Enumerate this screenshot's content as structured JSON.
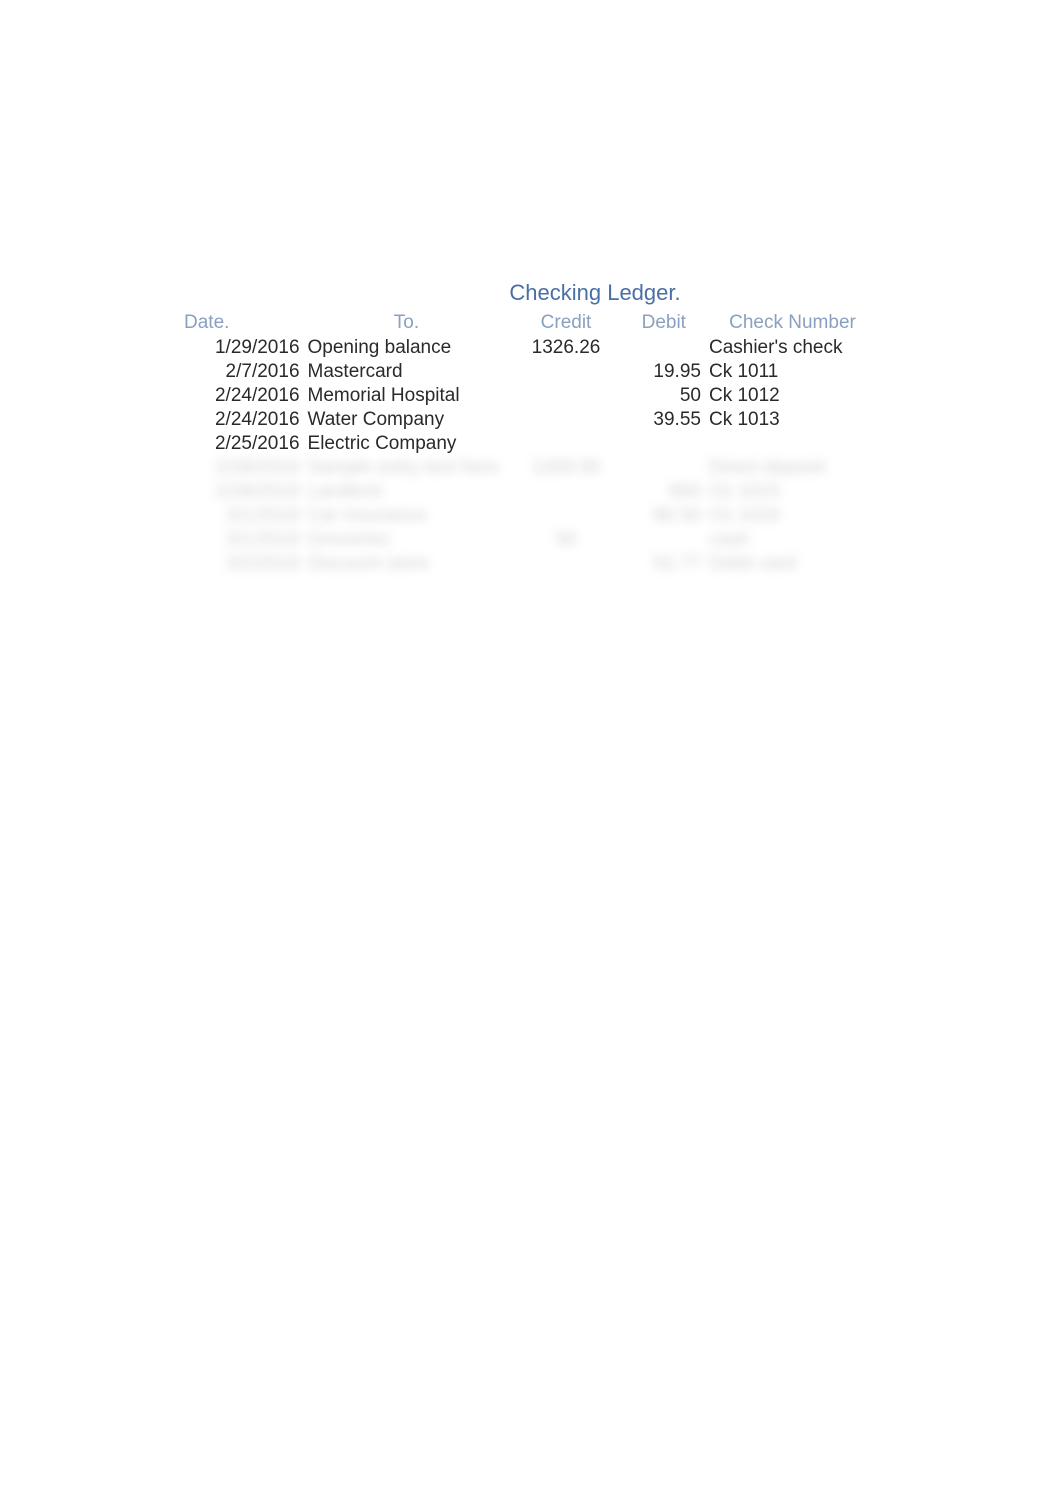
{
  "title": "Checking Ledger.",
  "columns": {
    "date": "Date.",
    "to": "To.",
    "credit": "Credit",
    "debit": "Debit",
    "check": "Check Number"
  },
  "rows": [
    {
      "date": "1/29/2016",
      "to": "Opening balance",
      "credit": "1326.26",
      "debit": "",
      "check": "Cashier's check",
      "blurred": false
    },
    {
      "date": "2/7/2016",
      "to": "Mastercard",
      "credit": "",
      "debit": "19.95",
      "check": "Ck 1011",
      "blurred": false
    },
    {
      "date": "2/24/2016",
      "to": "Memorial Hospital",
      "credit": "",
      "debit": "50",
      "check": "Ck 1012",
      "blurred": false
    },
    {
      "date": "2/24/2016",
      "to": "Water Company",
      "credit": "",
      "debit": "39.55",
      "check": "Ck 1013",
      "blurred": false
    },
    {
      "date": "2/25/2016",
      "to": "Electric Company",
      "credit": "",
      "debit": "",
      "check": "",
      "blurred": false
    },
    {
      "date": "2/28/2016",
      "to": "Sample entry text here",
      "credit": "1200.00",
      "debit": "",
      "check": "Direct deposit",
      "blurred": true
    },
    {
      "date": "2/28/2016",
      "to": "Landlord",
      "credit": "",
      "debit": "800",
      "check": "Ck 1015",
      "blurred": true
    },
    {
      "date": "3/1/2016",
      "to": "Car Insurance",
      "credit": "",
      "debit": "86.50",
      "check": "Ck 1016",
      "blurred": true
    },
    {
      "date": "3/1/2016",
      "to": "Groceries",
      "credit": "50",
      "debit": "",
      "check": "cash",
      "blurred": true
    },
    {
      "date": "3/2/2016",
      "to": "Discount store",
      "credit": "",
      "debit": "52.77",
      "check": "Debit card",
      "blurred": true
    }
  ]
}
